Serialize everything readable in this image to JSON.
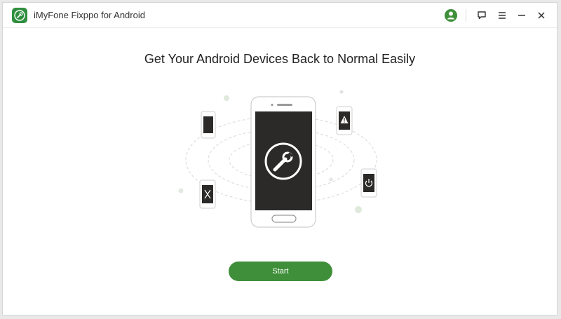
{
  "app": {
    "title": "iMyFone Fixppo for Android",
    "logo_icon": "wrench-logo-icon"
  },
  "titlebar": {
    "buttons": [
      "account-icon",
      "feedback-icon",
      "menu-icon",
      "minimize-icon",
      "close-icon"
    ]
  },
  "main": {
    "headline": "Get Your Android Devices Back to Normal Easily",
    "start_label": "Start"
  },
  "colors": {
    "brand_green": "#3f8f3a",
    "logo_green": "#2f8f3f",
    "phone_screen": "#2b2a28"
  }
}
